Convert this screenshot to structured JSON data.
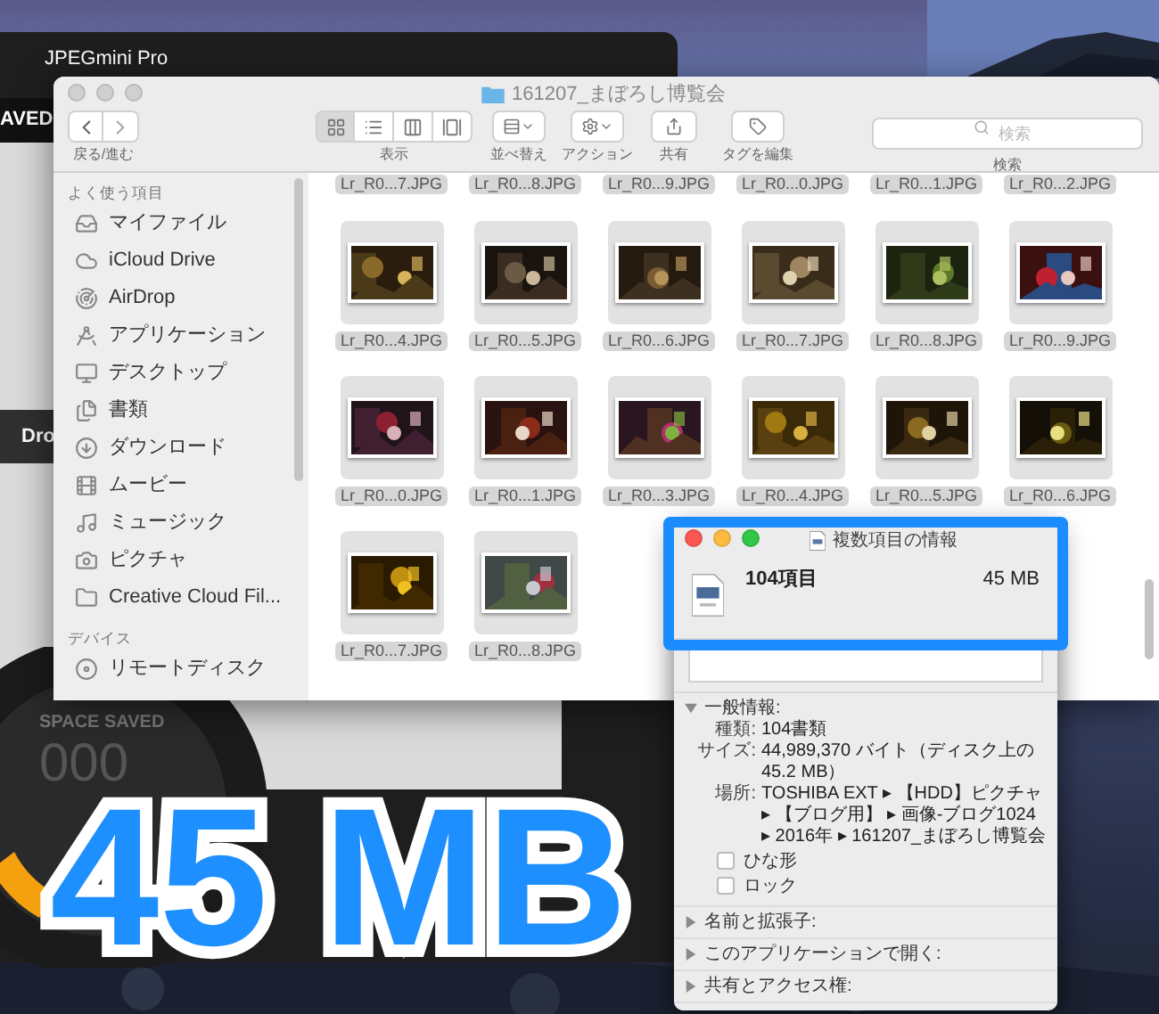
{
  "desktop_app": {
    "title": "JPEGmini Pro",
    "header_text": "AVED",
    "button_text": "Dro",
    "meter_label": "SPACE SAVED",
    "meter_value": "000"
  },
  "finder": {
    "title": "161207_まぼろし博覧会",
    "active": false,
    "toolbar": {
      "nav_label": "戻る/進む",
      "view_buttons": [
        {
          "selected": true
        },
        {
          "selected": false
        },
        {
          "selected": false
        },
        {
          "selected": false
        }
      ],
      "view_label": "表示",
      "sort_label": "並べ替え",
      "action_label": "アクション",
      "share_label": "共有",
      "tags_label": "タグを編集",
      "search_placeholder": "検索",
      "search_label": "検索"
    },
    "sidebar": {
      "sections": [
        {
          "title": "よく使う項目",
          "items": [
            {
              "label": "マイファイル"
            },
            {
              "label": "iCloud Drive"
            },
            {
              "label": "AirDrop"
            },
            {
              "label": "アプリケーション"
            },
            {
              "label": "デスクトップ"
            },
            {
              "label": "書類"
            },
            {
              "label": "ダウンロード"
            },
            {
              "label": "ムービー"
            },
            {
              "label": "ミュージック"
            },
            {
              "label": "ピクチャ"
            },
            {
              "label": "Creative Cloud Fil..."
            }
          ]
        },
        {
          "title": "デバイス",
          "items": [
            {
              "label": "リモートディスク"
            }
          ]
        }
      ]
    },
    "cut_row": [
      "Lr_R0...7.JPG",
      "Lr_R0...8.JPG",
      "Lr_R0...9.JPG",
      "Lr_R0...0.JPG",
      "Lr_R0...1.JPG",
      "Lr_R0...2.JPG"
    ],
    "files": [
      {
        "name": "Lr_R0...4.JPG"
      },
      {
        "name": "Lr_R0...5.JPG"
      },
      {
        "name": "Lr_R0...6.JPG"
      },
      {
        "name": "Lr_R0...7.JPG"
      },
      {
        "name": "Lr_R0...8.JPG"
      },
      {
        "name": "Lr_R0...9.JPG"
      },
      {
        "name": "Lr_R0...0.JPG"
      },
      {
        "name": "Lr_R0...1.JPG"
      },
      {
        "name": "Lr_R0...3.JPG"
      },
      {
        "name": "Lr_R0...4.JPG"
      },
      {
        "name": "Lr_R0...5.JPG"
      },
      {
        "name": "Lr_R0...6.JPG"
      },
      {
        "name": "Lr_R0...7.JPG"
      },
      {
        "name": "Lr_R0...8.JPG"
      }
    ]
  },
  "info_window": {
    "title": "複数項目の情報",
    "active": true,
    "summary": {
      "name": "104項目",
      "size": "45 MB"
    },
    "sections": [
      {
        "title": "一般情報:",
        "expanded": true,
        "rows": [
          {
            "label": "種類:",
            "value": "104書類"
          },
          {
            "label": "サイズ:",
            "value": "44,989,370 バイト（ディスク上の45.2 MB）"
          },
          {
            "label": "場所:",
            "value": "TOSHIBA EXT ▸ 【HDD】ピクチャ ▸ 【ブログ用】 ▸ 画像-ブログ1024 ▸ 2016年 ▸ 161207_まぼろし博覧会"
          }
        ],
        "checkboxes": [
          {
            "label": "ひな形",
            "checked": false
          },
          {
            "label": "ロック",
            "checked": false
          }
        ]
      },
      {
        "title": "名前と拡張子:",
        "expanded": false
      },
      {
        "title": "このアプリケーションで開く:",
        "expanded": false
      },
      {
        "title": "共有とアクセス権:",
        "expanded": false
      }
    ]
  },
  "caption": "45 MB"
}
